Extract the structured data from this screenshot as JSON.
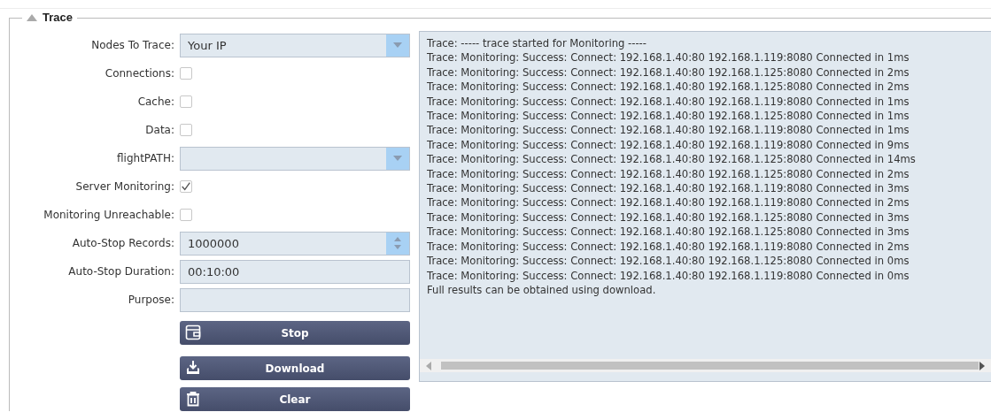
{
  "section": {
    "title": "Trace",
    "expanded": true
  },
  "fields": [
    {
      "kind": "select",
      "label": "Nodes To Trace:",
      "value": "Your IP"
    },
    {
      "kind": "checkbox",
      "label": "Connections:",
      "checked": false
    },
    {
      "kind": "checkbox",
      "label": "Cache:",
      "checked": false
    },
    {
      "kind": "checkbox",
      "label": "Data:",
      "checked": false
    },
    {
      "kind": "select",
      "label": "flightPATH:"
    },
    {
      "kind": "checkbox",
      "label": "Server Monitoring:",
      "checked": true
    },
    {
      "kind": "checkbox",
      "label": "Monitoring Unreachable:",
      "checked": false
    },
    {
      "kind": "spinner",
      "label": "Auto-Stop Records:",
      "value": "1000000"
    },
    {
      "kind": "text",
      "label": "Auto-Stop Duration:",
      "value": "00:10:00"
    },
    {
      "kind": "text",
      "label": "Purpose:"
    }
  ],
  "buttons": [
    {
      "kind": "stop",
      "label": "Stop"
    },
    {
      "kind": "download",
      "label": "Download"
    },
    {
      "kind": "clear",
      "label": "Clear"
    }
  ],
  "log": [
    "Trace: ----- trace started for Monitoring -----",
    "Trace: Monitoring: Success: Connect: 192.168.1.40:80 192.168.1.119:8080 Connected in 1ms",
    "Trace: Monitoring: Success: Connect: 192.168.1.40:80 192.168.1.125:8080 Connected in 2ms",
    "Trace: Monitoring: Success: Connect: 192.168.1.40:80 192.168.1.125:8080 Connected in 2ms",
    "Trace: Monitoring: Success: Connect: 192.168.1.40:80 192.168.1.119:8080 Connected in 1ms",
    "Trace: Monitoring: Success: Connect: 192.168.1.40:80 192.168.1.125:8080 Connected in 1ms",
    "Trace: Monitoring: Success: Connect: 192.168.1.40:80 192.168.1.119:8080 Connected in 1ms",
    "Trace: Monitoring: Success: Connect: 192.168.1.40:80 192.168.1.119:8080 Connected in 9ms",
    "Trace: Monitoring: Success: Connect: 192.168.1.40:80 192.168.1.125:8080 Connected in 14ms",
    "Trace: Monitoring: Success: Connect: 192.168.1.40:80 192.168.1.125:8080 Connected in 2ms",
    "Trace: Monitoring: Success: Connect: 192.168.1.40:80 192.168.1.119:8080 Connected in 3ms",
    "Trace: Monitoring: Success: Connect: 192.168.1.40:80 192.168.1.119:8080 Connected in 2ms",
    "Trace: Monitoring: Success: Connect: 192.168.1.40:80 192.168.1.125:8080 Connected in 3ms",
    "Trace: Monitoring: Success: Connect: 192.168.1.40:80 192.168.1.125:8080 Connected in 3ms",
    "Trace: Monitoring: Success: Connect: 192.168.1.40:80 192.168.1.119:8080 Connected in 2ms",
    "Trace: Monitoring: Success: Connect: 192.168.1.40:80 192.168.1.125:8080 Connected in 0ms",
    "Trace: Monitoring: Success: Connect: 192.168.1.40:80 192.168.1.119:8080 Connected in 0ms",
    "Full results can be obtained using download."
  ]
}
